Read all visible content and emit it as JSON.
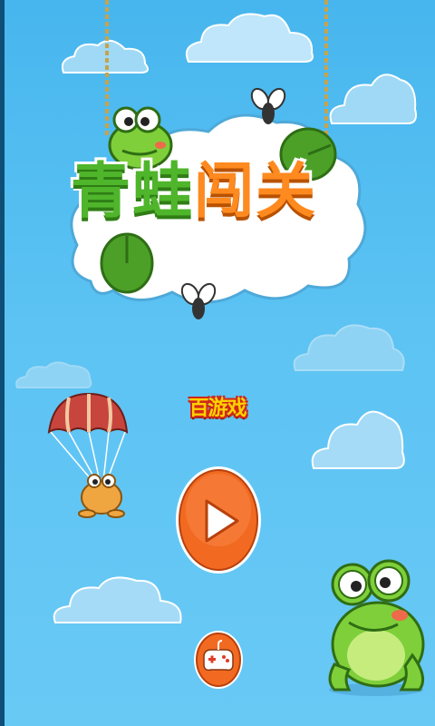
{
  "game": {
    "title_part1": "青蛙",
    "title_part2": "闯关",
    "brand": "百游戏"
  },
  "buttons": {
    "play_icon": "play-icon",
    "more_games_icon": "gamepad-icon"
  },
  "colors": {
    "sky_top": "#47b6ee",
    "sky_bottom": "#69c9f5",
    "title_green": "#4fb52b",
    "title_orange": "#ff8a1f",
    "button_orange": "#f26a21",
    "frog_green": "#7fcf3a"
  }
}
